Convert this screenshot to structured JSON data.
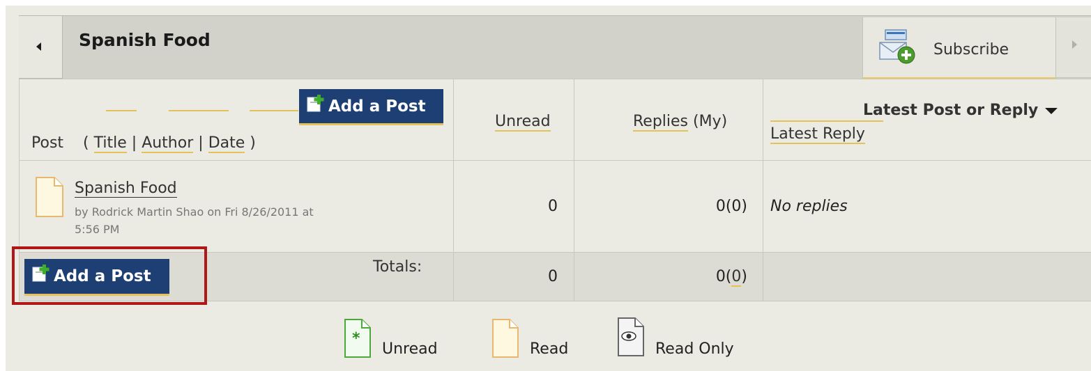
{
  "forum": {
    "title": "Spanish Food",
    "subscribe_label": "Subscribe"
  },
  "header": {
    "add_post_label": "Add a Post",
    "post_label": "Post",
    "paren_open": "(",
    "sort_title": "Title",
    "sep1": "|",
    "sort_author": "Author",
    "sep2": "|",
    "sort_date": "Date",
    "paren_close": ")",
    "col_unread": "Unread",
    "col_replies": "Replies",
    "col_my": "(My)",
    "col_latest": "Latest Post or Reply",
    "col_latest_reply": "Latest Reply"
  },
  "posts": [
    {
      "title": "Spanish Food",
      "meta_line1": "by Rodrick Martin Shao  on Fri 8/26/2011 at",
      "meta_line2": "5:56 PM",
      "unread": "0",
      "replies": "0(0)",
      "latest": "No replies"
    }
  ],
  "totals": {
    "label": "Totals:",
    "unread": "0",
    "replies_prefix": "0(",
    "replies_my": "0",
    "replies_suffix": ")",
    "add_post_label": "Add a Post"
  },
  "legend": {
    "unread": "Unread",
    "read": "Read",
    "read_only": "Read Only"
  },
  "colors": {
    "button_bg": "#1d3f73",
    "accent_underline": "#e2c259",
    "highlight_border": "#b01818"
  }
}
